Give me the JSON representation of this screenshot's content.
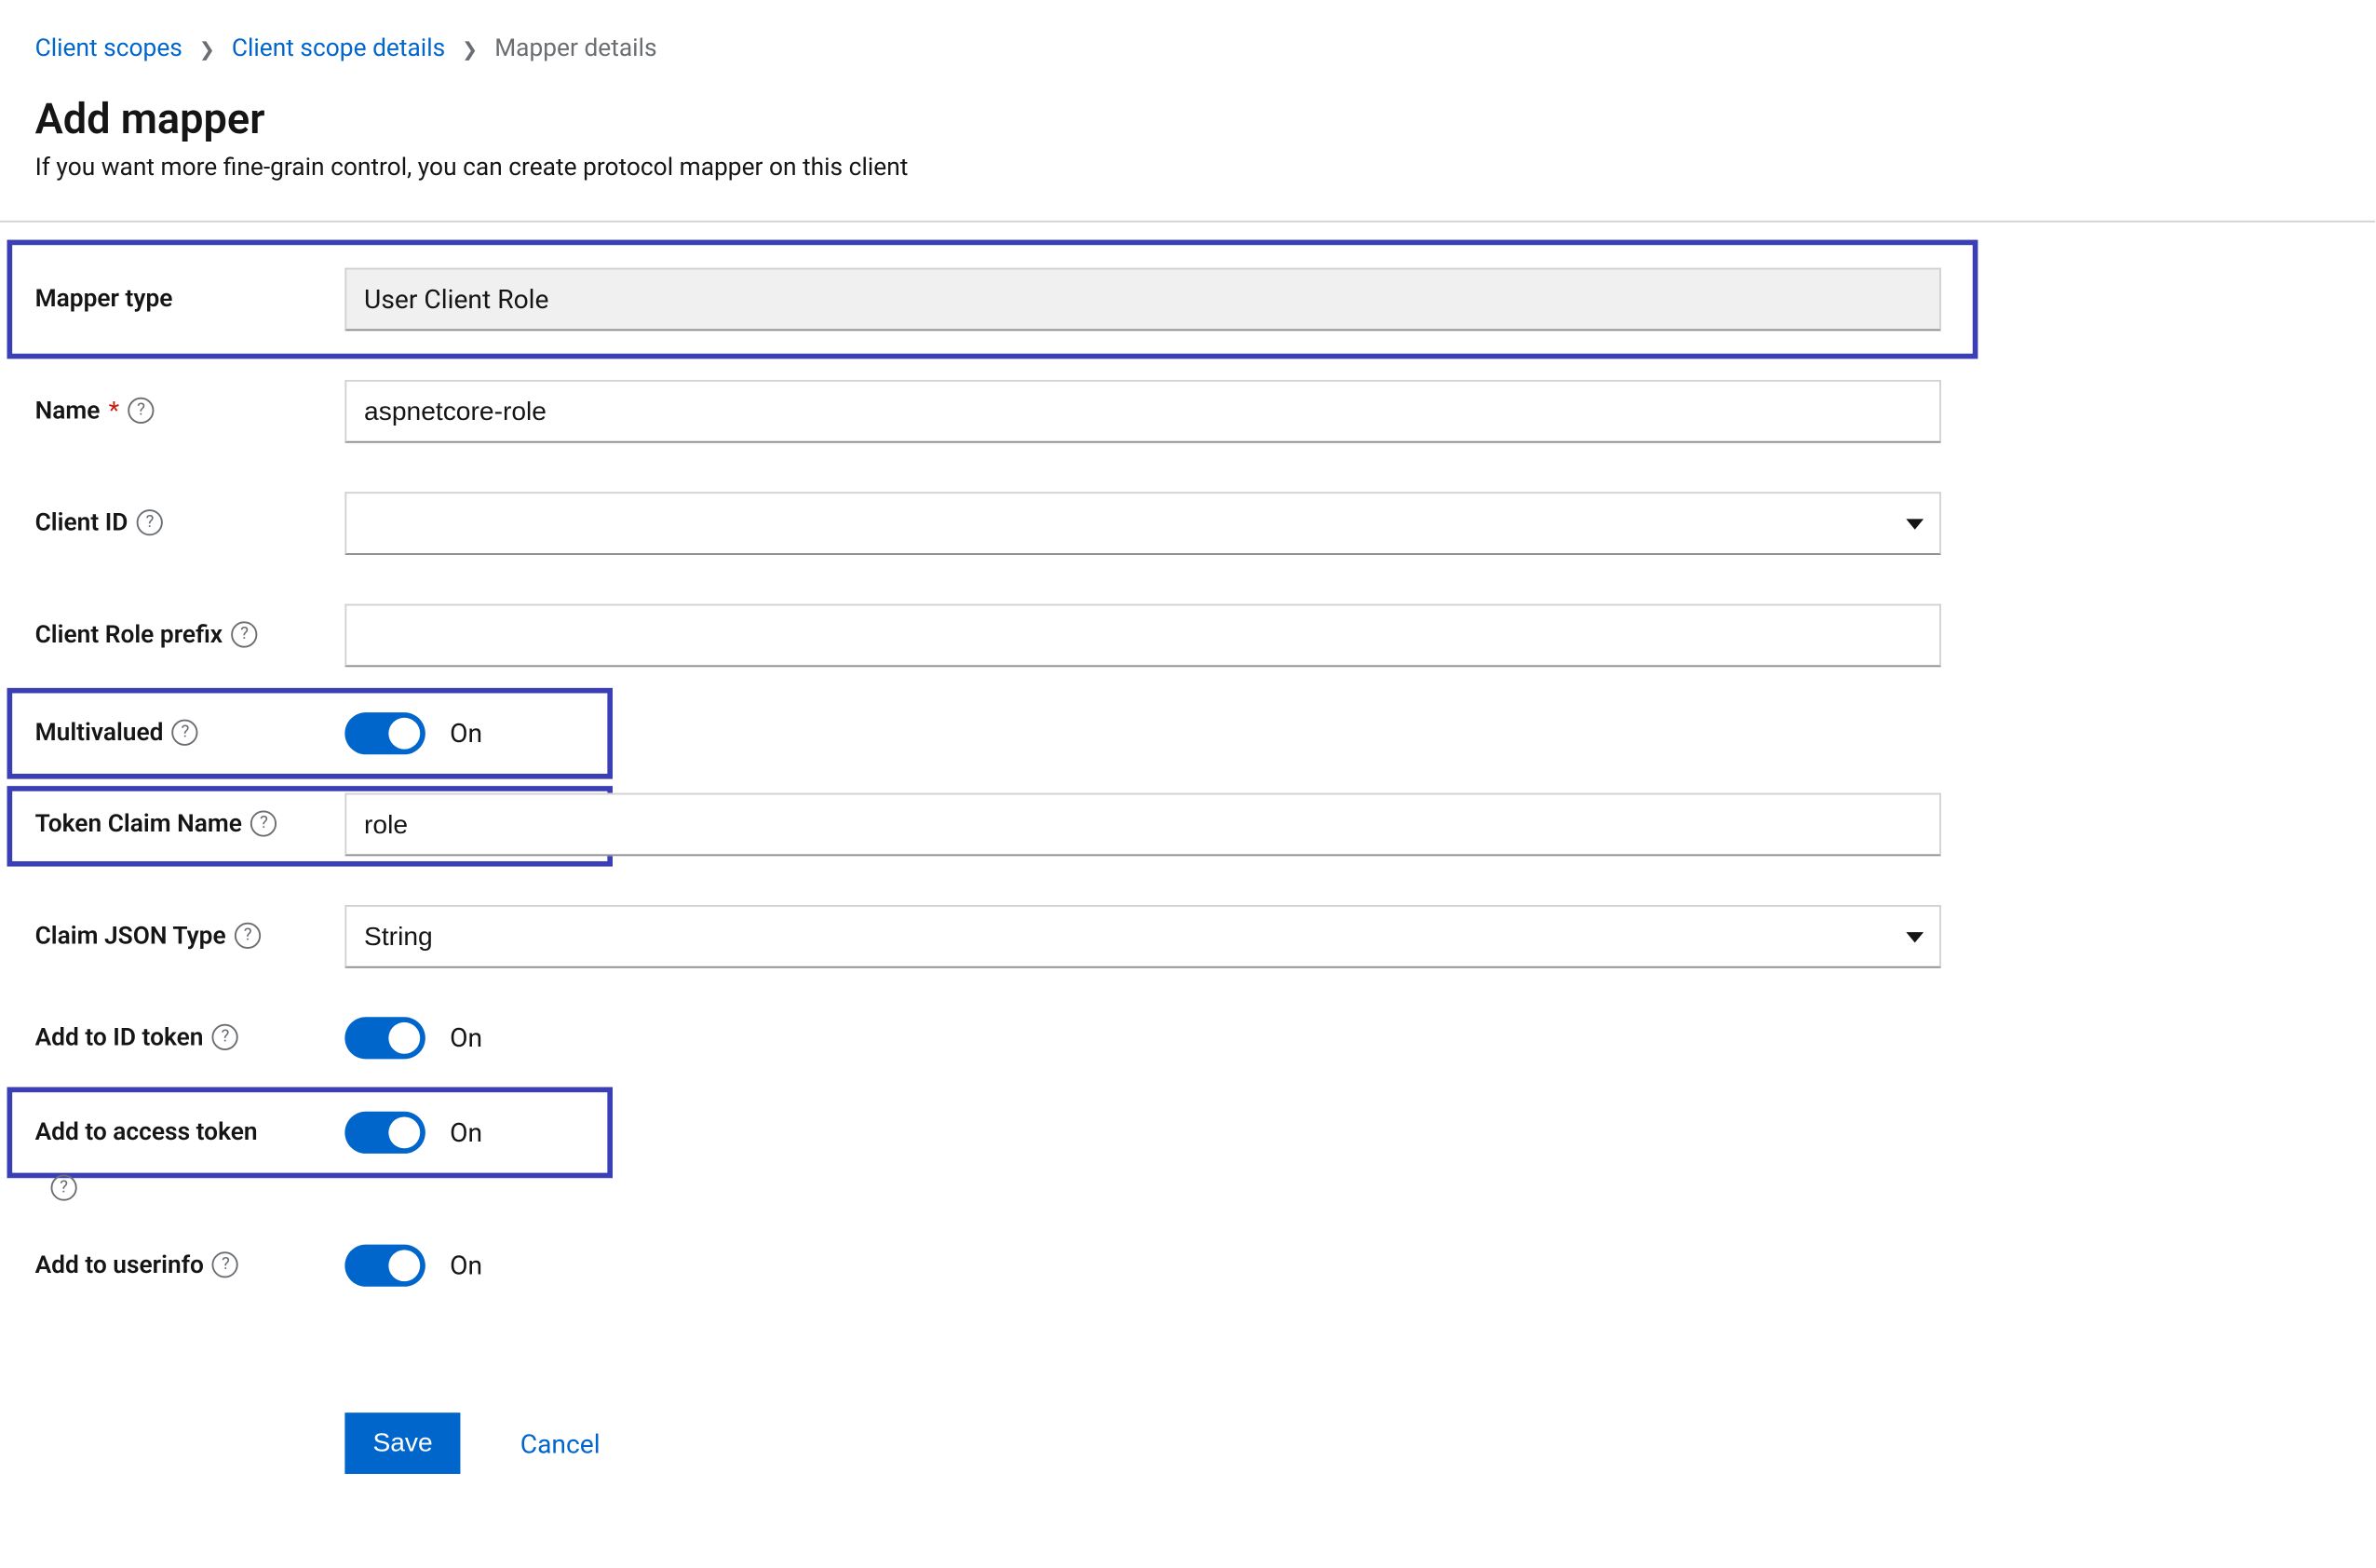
{
  "breadcrumb": {
    "items": [
      "Client scopes",
      "Client scope details",
      "Mapper details"
    ]
  },
  "header": {
    "title": "Add mapper",
    "subtitle": "If you want more fine-grain control, you can create protocol mapper on this client"
  },
  "form": {
    "mapper_type": {
      "label": "Mapper type",
      "value": "User Client Role"
    },
    "name": {
      "label": "Name",
      "value": "aspnetcore-role"
    },
    "client_id": {
      "label": "Client ID",
      "value": ""
    },
    "client_role_prefix": {
      "label": "Client Role prefix",
      "value": ""
    },
    "multivalued": {
      "label": "Multivalued",
      "value": "On"
    },
    "token_claim_name": {
      "label": "Token Claim Name",
      "value": "role"
    },
    "claim_json_type": {
      "label": "Claim JSON Type",
      "value": "String"
    },
    "add_to_id_token": {
      "label": "Add to ID token",
      "value": "On"
    },
    "add_to_access_token": {
      "label": "Add to access token",
      "value": "On"
    },
    "add_to_userinfo": {
      "label": "Add to userinfo",
      "value": "On"
    }
  },
  "actions": {
    "save": "Save",
    "cancel": "Cancel"
  }
}
